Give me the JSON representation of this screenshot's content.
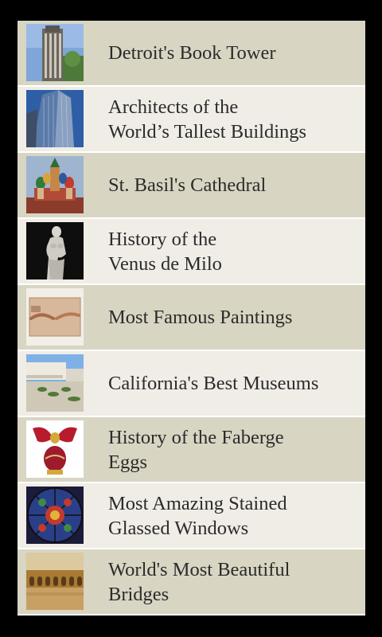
{
  "list": {
    "items": [
      {
        "title": "Detroit's Book Tower",
        "thumbnail_icon": "tower-photo"
      },
      {
        "title": "Architects of the\nWorld’s Tallest Buildings",
        "thumbnail_icon": "skyscraper-photo"
      },
      {
        "title": "St. Basil's Cathedral",
        "thumbnail_icon": "cathedral-photo"
      },
      {
        "title": "History of the\nVenus de Milo",
        "thumbnail_icon": "statue-photo"
      },
      {
        "title": "Most Famous Paintings",
        "thumbnail_icon": "painting-photo"
      },
      {
        "title": "California's Best Museums",
        "thumbnail_icon": "museum-photo"
      },
      {
        "title": "History of the Faberge\nEggs",
        "thumbnail_icon": "egg-photo"
      },
      {
        "title": "Most Amazing Stained\nGlassed Windows",
        "thumbnail_icon": "stained-glass-photo"
      },
      {
        "title": "World's Most Beautiful\nBridges",
        "thumbnail_icon": "bridge-photo"
      }
    ]
  }
}
